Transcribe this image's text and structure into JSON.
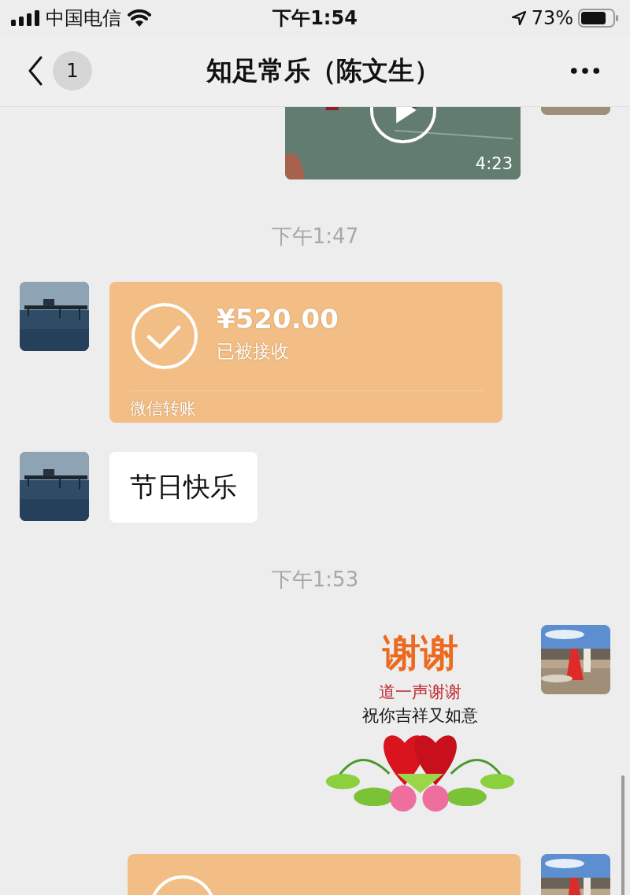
{
  "status_bar": {
    "carrier": "中国电信",
    "time": "下午1:54",
    "battery": "73%"
  },
  "nav": {
    "back_badge": "1",
    "title": "知足常乐（陈文生）"
  },
  "messages": [
    {
      "kind": "video",
      "outgoing": true,
      "duration": "4:23"
    },
    {
      "kind": "time",
      "text": "下午1:47"
    },
    {
      "kind": "transfer",
      "outgoing": false,
      "amount": "¥520.00",
      "status": "已被接收",
      "footer": "微信转账"
    },
    {
      "kind": "text",
      "outgoing": false,
      "text": "节日快乐"
    },
    {
      "kind": "time",
      "text": "下午1:53"
    },
    {
      "kind": "sticker",
      "outgoing": true,
      "title": "谢谢",
      "lines": [
        "道一声谢谢",
        "祝你吉祥又如意"
      ]
    },
    {
      "kind": "transfer",
      "outgoing": true
    }
  ]
}
